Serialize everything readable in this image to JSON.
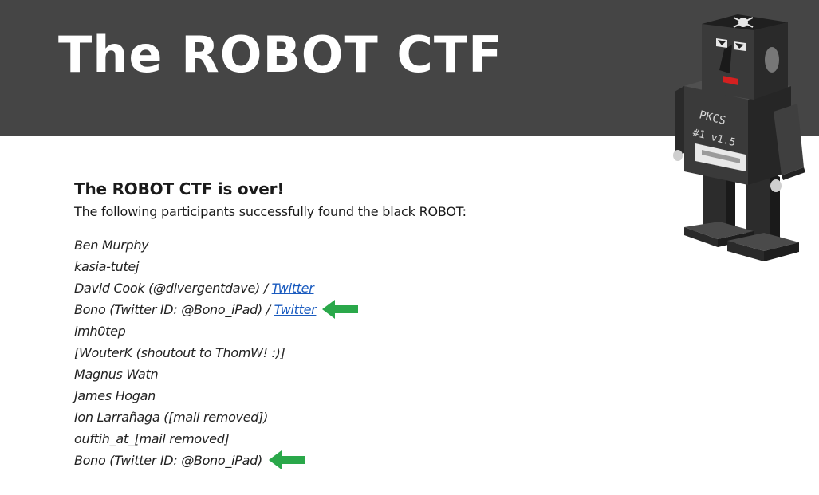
{
  "header": {
    "title": "The ROBOT CTF",
    "background": "#454545"
  },
  "robot": {
    "chest_text_line1": "PKCS",
    "chest_text_line2": "#1 v1.5"
  },
  "main": {
    "heading": "The ROBOT CTF is over!",
    "subtitle": "The following participants successfully found the black ROBOT:",
    "participants": [
      {
        "name": "Ben Murphy"
      },
      {
        "name": "kasia-tutej"
      },
      {
        "name": "David Cook (@divergentdave) / ",
        "link": "Twitter"
      },
      {
        "name": "Bono (Twitter ID: @Bono_iPad) / ",
        "link": "Twitter",
        "marker": "green-arrow-icon"
      },
      {
        "name": "imh0tep"
      },
      {
        "name": "[WouterK (shoutout to ThomW! :)]"
      },
      {
        "name": "Magnus Watn"
      },
      {
        "name": "James Hogan"
      },
      {
        "name": "Ion Larrañaga ([mail removed])"
      },
      {
        "name": "ouftih_at_[mail removed]"
      },
      {
        "name": "Bono (Twitter ID: @Bono_iPad)",
        "marker": "green-arrow-icon"
      }
    ]
  },
  "colors": {
    "link": "#1a5bbf",
    "arrow": "#2aa84a",
    "header_text": "#ffffff"
  }
}
